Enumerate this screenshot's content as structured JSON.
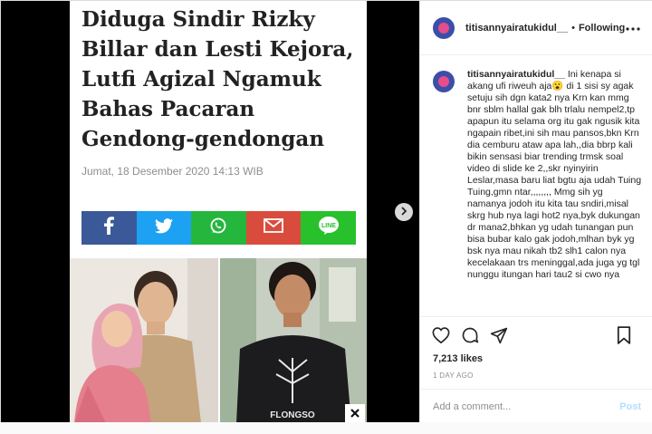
{
  "colors": {
    "facebook": "#3b5998",
    "twitter": "#1da1f2",
    "whatsapp": "#25b63e",
    "email": "#d94c3d",
    "line": "#28c12c",
    "post_disabled": "#b2dffc"
  },
  "article": {
    "headline": "Diduga Sindir Rizky Billar dan Lesti Kejora, Lutfi Agizal Ngamuk Bahas Pacaran Gendong-gendongan",
    "date": "Jumat, 18 Desember 2020 14:13 WIB",
    "share": [
      {
        "name": "facebook",
        "icon": "facebook-icon"
      },
      {
        "name": "twitter",
        "icon": "twitter-icon"
      },
      {
        "name": "whatsapp",
        "icon": "whatsapp-icon"
      },
      {
        "name": "email",
        "icon": "email-icon"
      },
      {
        "name": "line",
        "icon": "line-icon",
        "label": "LINE"
      }
    ],
    "shirt_text": "FLONGSO"
  },
  "header": {
    "username": "titisannyairatukidul__",
    "separator": "•",
    "follow_label": "Following",
    "more_icon": "more-icon"
  },
  "comment": {
    "username": "titisannyairatukidul__",
    "text": "Ini kenapa si akang ufi riweuh aja😮 di 1 sisi sy agak setuju sih dgn kata2 nya Krn kan mmg bnr sblm hallal gak blh trlalu nempel2,tp apapun itu selama org itu gak ngusik kita ngapain ribet,ini sih mau pansos,bkn Krn dia cemburu ataw apa lah,,dia bbrp kali bikin sensasi biar trending trmsk soal video di slide ke 2,,skr nyinyirin Leslar,masa baru liat bgtu aja udah Tuing Tuing,gmn ntar,,,,,,,, Mmg sih yg namanya jodoh itu kita tau sndiri,misal skrg hub nya lagi hot2 nya,byk dukungan dr mana2,bhkan yg udah tunangan pun bisa bubar kalo gak jodoh,mlhan byk yg bsk nya mau nikah tb2 slh1 calon nya kecelakaan trs meninggal,ada juga yg tgl nunggu itungan hari tau2 si cwo nya"
  },
  "actions": {
    "icons": [
      "heart-icon",
      "comment-icon",
      "share-icon",
      "bookmark-icon"
    ],
    "likes": "7,213 likes",
    "time_ago": "1 DAY AGO"
  },
  "add_comment": {
    "placeholder": "Add a comment...",
    "post_label": "Post"
  }
}
